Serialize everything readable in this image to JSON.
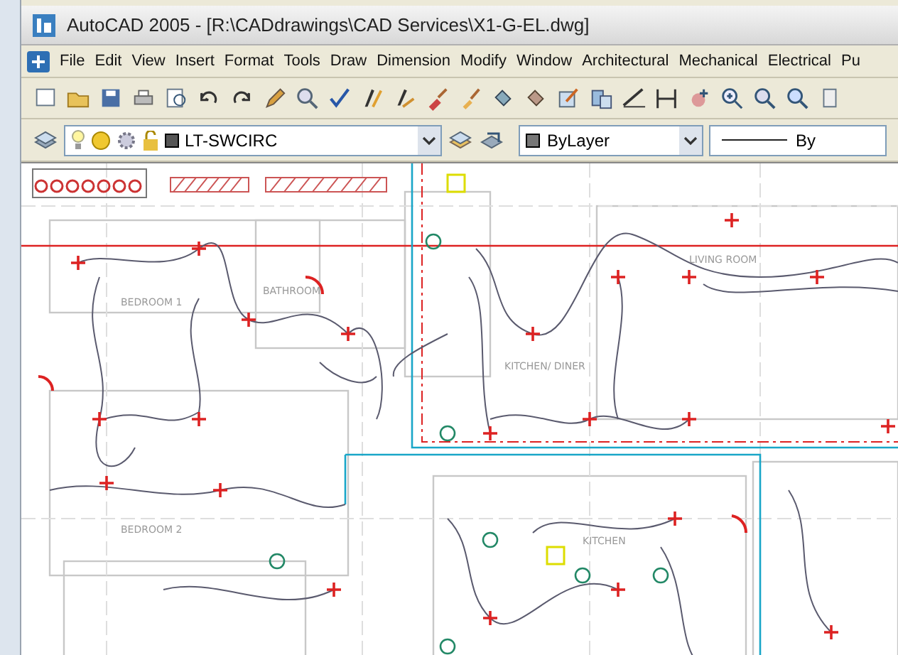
{
  "window": {
    "title": "AutoCAD 2005 - [R:\\CADdrawings\\CAD Services\\X1-G-EL.dwg]"
  },
  "menu": [
    "File",
    "Edit",
    "View",
    "Insert",
    "Format",
    "Tools",
    "Draw",
    "Dimension",
    "Modify",
    "Window",
    "Architectural",
    "Mechanical",
    "Electrical",
    "Pu"
  ],
  "layers_toolbar": {
    "layer": "LT-SWCIRC",
    "color_setting": "ByLayer",
    "linetype": "By"
  },
  "drawing": {
    "room_labels": [
      "BEDROOM 1",
      "BATHROOM",
      "LIVING ROOM",
      "KITCHEN/ DINER",
      "BEDROOM 2",
      "KITCHEN"
    ]
  }
}
